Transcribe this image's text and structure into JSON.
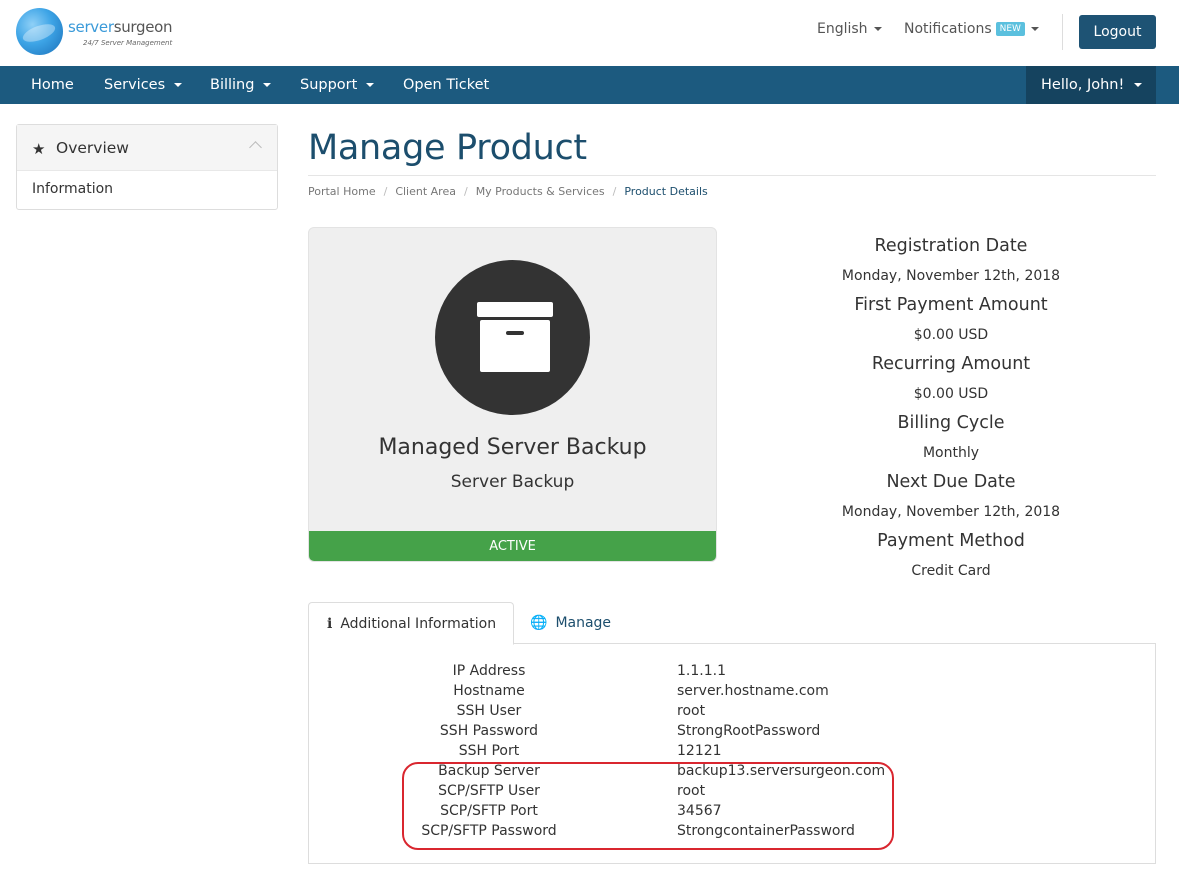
{
  "brand": {
    "name_part1": "server",
    "name_part2": "surgeon",
    "tagline": "24/7 Server Management"
  },
  "topbar": {
    "language": "English",
    "notifications": "Notifications",
    "notifications_badge": "NEW",
    "logout": "Logout"
  },
  "nav": {
    "items": [
      {
        "label": "Home"
      },
      {
        "label": "Services"
      },
      {
        "label": "Billing"
      },
      {
        "label": "Support"
      },
      {
        "label": "Open Ticket"
      }
    ],
    "user": "Hello, John!"
  },
  "sidebar": {
    "title": "Overview",
    "items": [
      {
        "label": "Information"
      }
    ]
  },
  "page": {
    "title": "Manage Product",
    "breadcrumb": [
      "Portal Home",
      "Client Area",
      "My Products & Services",
      "Product Details"
    ]
  },
  "product": {
    "icon": "archive-box-icon",
    "name": "Managed Server Backup",
    "group": "Server Backup",
    "status": "ACTIVE",
    "status_color": "#45a249"
  },
  "billing": [
    {
      "label": "Registration Date",
      "value": "Monday, November 12th, 2018"
    },
    {
      "label": "First Payment Amount",
      "value": "$0.00 USD"
    },
    {
      "label": "Recurring Amount",
      "value": "$0.00 USD"
    },
    {
      "label": "Billing Cycle",
      "value": "Monthly"
    },
    {
      "label": "Next Due Date",
      "value": "Monday, November 12th, 2018"
    },
    {
      "label": "Payment Method",
      "value": "Credit Card"
    }
  ],
  "tabs": [
    {
      "label": "Additional Information",
      "icon": "info-icon"
    },
    {
      "label": "Manage",
      "icon": "globe-icon"
    }
  ],
  "additional_info": [
    {
      "key": "IP Address",
      "value": "1.1.1.1"
    },
    {
      "key": "Hostname",
      "value": "server.hostname.com"
    },
    {
      "key": "SSH User",
      "value": "root"
    },
    {
      "key": "SSH Password",
      "value": "StrongRootPassword"
    },
    {
      "key": "SSH Port",
      "value": "12121"
    },
    {
      "key": "Backup Server",
      "value": "backup13.serversurgeon.com"
    },
    {
      "key": "SCP/SFTP User",
      "value": "root"
    },
    {
      "key": "SCP/SFTP Port",
      "value": "34567"
    },
    {
      "key": "SCP/SFTP Password",
      "value": "StrongcontainerPassword"
    }
  ],
  "colors": {
    "navbar": "#1c5a7f",
    "accent": "#1c4e6d",
    "highlight": "#d9262f"
  }
}
